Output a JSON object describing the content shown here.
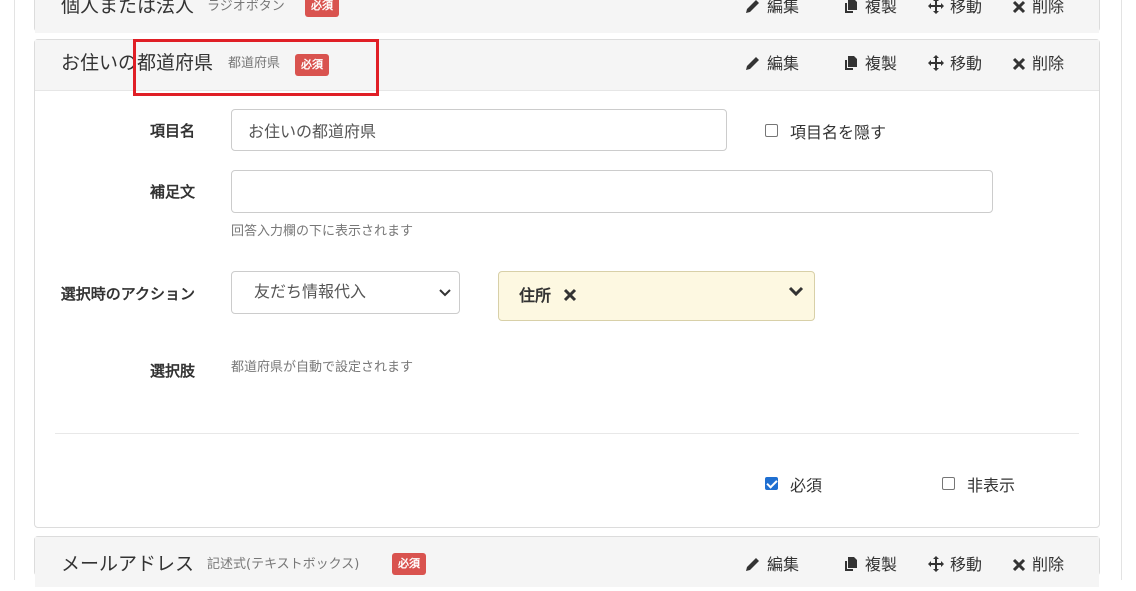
{
  "colors": {
    "badge": "#d9534f",
    "highlight": "#e01f26",
    "checkbox": "#1f6fd1",
    "tag_bg": "#fdf8e1"
  },
  "prev_item": {
    "title": "個人または法人",
    "type": "ラジオボタン",
    "badge": "必須"
  },
  "item": {
    "title": "お住いの都道府県",
    "type": "都道府県",
    "badge": "必須"
  },
  "next_item": {
    "title": "メールアドレス",
    "type": "記述式(テキストボックス)",
    "badge": "必須"
  },
  "actions": {
    "edit": "編集",
    "duplicate": "複製",
    "move": "移動",
    "delete": "削除"
  },
  "icons": [
    "pencil-icon",
    "copy-icon",
    "move-icon",
    "close-icon",
    "chevron-down-icon",
    "checkbox-icon"
  ],
  "form": {
    "name_label": "項目名",
    "name_value": "お住いの都道府県",
    "hide_name_label": "項目名を隠す",
    "note_label": "補足文",
    "note_value": "",
    "note_help": "回答入力欄の下に表示されます",
    "action_label": "選択時のアクション",
    "action_value": "友だち情報代入",
    "action_tag": "住所",
    "choices_label": "選択肢",
    "choices_help": "都道府県が自動で設定されます",
    "required_label": "必須",
    "required_checked": true,
    "hidden_label": "非表示",
    "hidden_checked": false
  }
}
